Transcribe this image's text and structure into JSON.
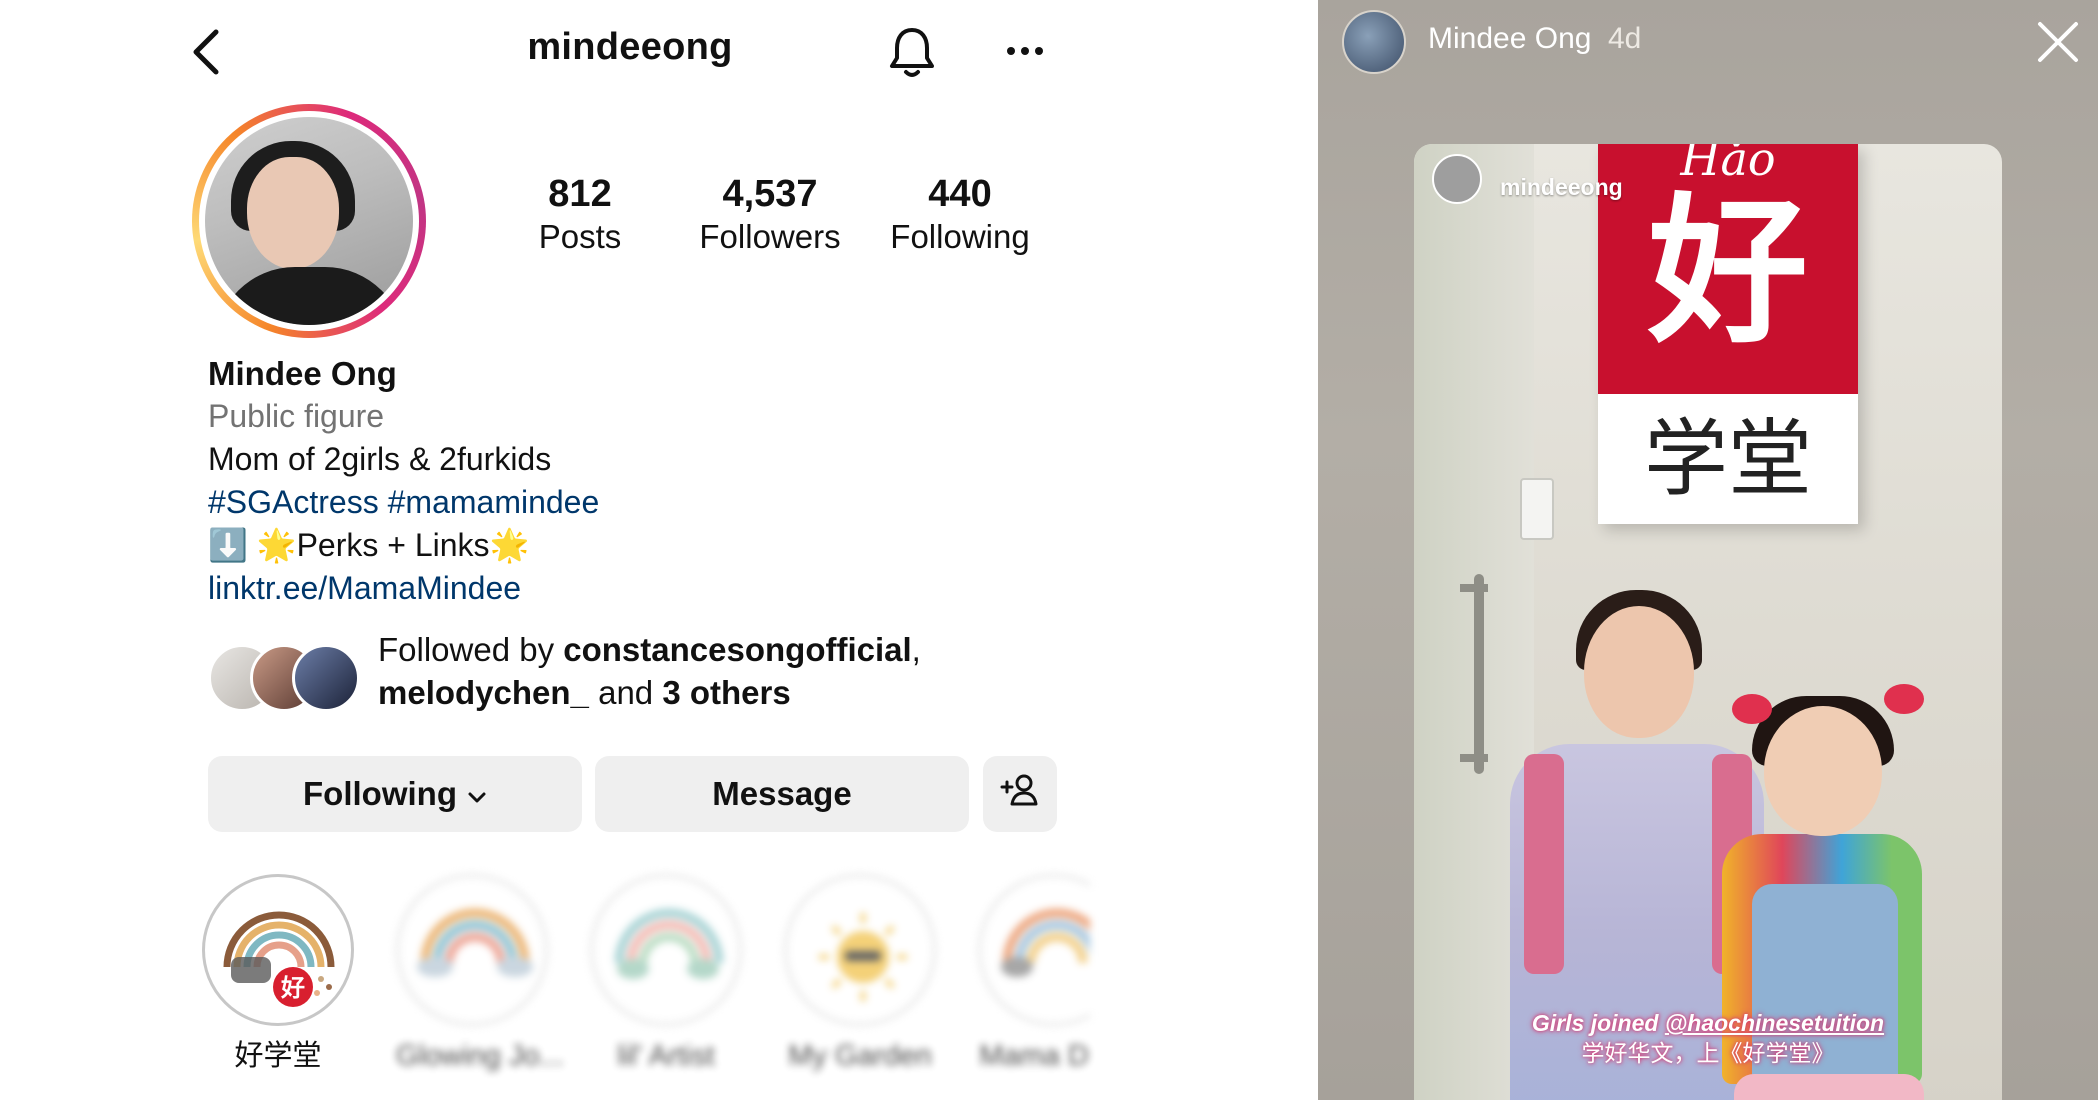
{
  "profile": {
    "username": "mindeeong",
    "stats": [
      {
        "value": "812",
        "label": "Posts"
      },
      {
        "value": "4,537",
        "label": "Followers"
      },
      {
        "value": "440",
        "label": "Following"
      }
    ],
    "name": "Mindee Ong",
    "category": "Public figure",
    "bio_line": "Mom of 2girls & 2furkids",
    "hashtags": "#SGActress #mamamindee",
    "perks_line": "⬇️ 🌟Perks + Links🌟",
    "link": "linktr.ee/MamaMindee",
    "followed_by": {
      "prefix": "Followed by ",
      "user1": "constancesongofficial",
      "comma": ",",
      "user2": "melodychen_",
      "and": " and ",
      "others": "3 others"
    },
    "buttons": {
      "following": "Following",
      "message": "Message"
    },
    "highlights": [
      {
        "label": "好学堂"
      },
      {
        "label": "Glowing Jo..."
      },
      {
        "label": "lil' Artist"
      },
      {
        "label": "My Garden"
      },
      {
        "label": "Mama D"
      }
    ]
  },
  "story": {
    "user": "Mindee Ong",
    "time": "4d",
    "shared_user": "mindeeong",
    "sign": {
      "roman": "Hǎo",
      "big": "好",
      "sub": "学堂"
    },
    "caption_line1_prefix": "Girls joined ",
    "caption_line1_handle": "@haochinesetuition",
    "caption_line2": "学好华文，上《好学堂》"
  },
  "colors": {
    "link_blue": "#00376b",
    "button_gray": "#efefef",
    "muted_text": "#737373",
    "sign_red": "#c8102e"
  }
}
